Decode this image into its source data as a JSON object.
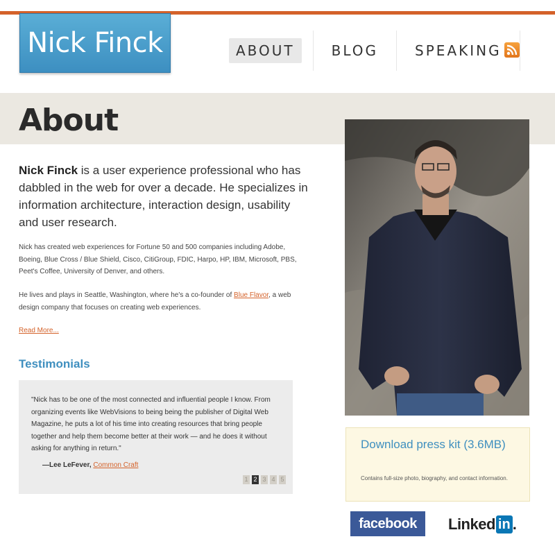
{
  "site": {
    "logo_text": "Nick Finck"
  },
  "nav": {
    "items": [
      {
        "label": "ABOUT"
      },
      {
        "label": "BLOG"
      },
      {
        "label": "SPEAKING"
      }
    ],
    "rss_icon": "rss-icon",
    "rss_color": "#e67e22"
  },
  "page": {
    "title": "About",
    "lead_name": "Nick Finck",
    "lead_text": " is a user experience professional who has dabbled in the web for over a decade. He specializes in information architecture, interaction design, usability and user research.",
    "p1": "Nick has created web experiences for Fortune 50 and 500 companies including Adobe, Boeing, Blue Cross / Blue Shield, Cisco, CitiGroup, FDIC, Harpo, HP, IBM, Microsoft, PBS, Peet's Coffee, University of Denver, and others.",
    "p2_before": "He lives and plays in Seattle, Washington, where he's a co-founder of ",
    "p2_link": "Blue Flavor",
    "p2_after": ", a web design company that focuses on creating web experiences.",
    "read_more": "Read More..."
  },
  "testimonials": {
    "title": "Testimonials",
    "quote": "\"Nick has to be one of the most connected and influential people I know. From organizing events like WebVisions to being being the publisher of Digital Web Magazine, he puts a lot of his time into creating resources that bring people together and help them become better at their work — and he does it without asking for anything in return.\"",
    "author": "—Lee LeFever, ",
    "author_link": "Common Craft",
    "pages": [
      "1",
      "2",
      "3",
      "4",
      "5"
    ],
    "current_page": "2"
  },
  "press": {
    "title": "Download press kit (3.6MB)",
    "desc": "Contains full-size photo, biography, and contact information."
  },
  "social": {
    "facebook": "facebook",
    "linkedin_text": "Linked",
    "linkedin_box": "in",
    "linkedin_suffix": "."
  },
  "colors": {
    "accent_orange": "#d4622a",
    "brand_blue": "#3f8fbf",
    "facebook_blue": "#3b5998",
    "linkedin_blue": "#0a77b5"
  }
}
